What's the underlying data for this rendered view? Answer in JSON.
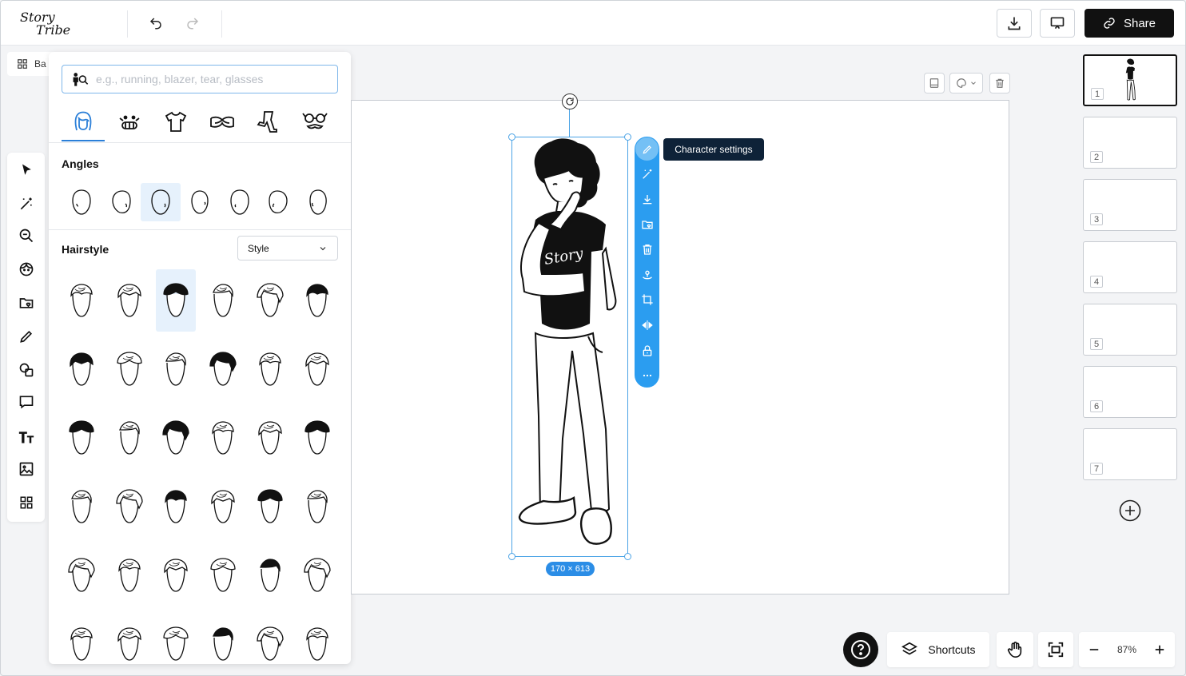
{
  "header": {
    "logo_line1": "Story",
    "logo_line2": "Tribe",
    "share_label": "Share"
  },
  "tab_chip": {
    "label": "Ba"
  },
  "panel": {
    "search_placeholder": "e.g., running, blazer, tear, glasses",
    "categories": [
      "hair-icon",
      "face-icon",
      "shirt-icon",
      "arms-icon",
      "legs-icon",
      "accessories-icon"
    ],
    "angles_title": "Angles",
    "angles_count": 7,
    "angles_selected": 3,
    "hairstyle_title": "Hairstyle",
    "style_select": "Style",
    "hairstyle_selected": 3
  },
  "canvas": {
    "dims_label": "170 × 613",
    "tooltip": "Character settings",
    "context_icons": [
      "pencil-icon",
      "magic-wand-icon",
      "download-icon",
      "folder-heart-icon",
      "trash-icon",
      "anchor-icon",
      "crop-icon",
      "flip-icon",
      "lock-icon",
      "more-icon"
    ]
  },
  "pages": [
    "1",
    "2",
    "3",
    "4",
    "5",
    "6",
    "7"
  ],
  "bottom": {
    "shortcuts_label": "Shortcuts",
    "zoom_level": "87%"
  },
  "colors": {
    "accent": "#2b9df0",
    "selection": "#4aa3e6",
    "tooltip_bg": "#0e2238",
    "share_bg": "#111111"
  }
}
